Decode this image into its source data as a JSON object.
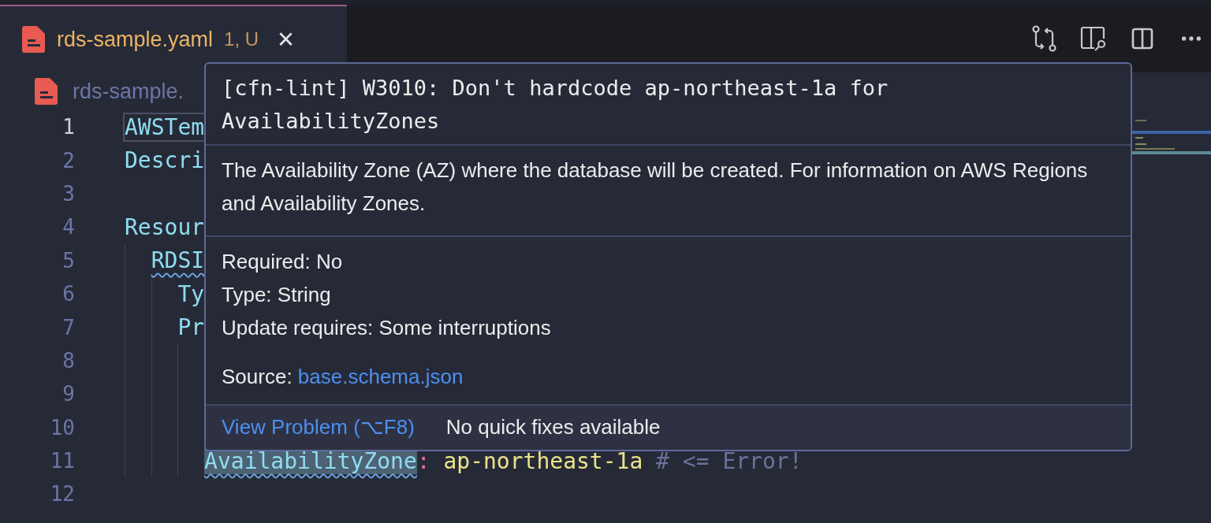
{
  "tab": {
    "filename": "rds-sample.yaml",
    "badge": "1, U",
    "close": "×",
    "selected": true
  },
  "breadcrumb": {
    "text": "rds-sample."
  },
  "editor": {
    "lines": [
      {
        "number": "1",
        "current": true,
        "tokens": [
          {
            "kind": "key",
            "text": "AWSTem",
            "outlined": true,
            "highlighted": false,
            "squiggle": false
          }
        ]
      },
      {
        "number": "2",
        "current": false,
        "tokens": [
          {
            "kind": "key",
            "text": "Descri",
            "outlined": false,
            "highlighted": false,
            "squiggle": false
          }
        ]
      },
      {
        "number": "3",
        "current": false
      },
      {
        "number": "4",
        "current": false,
        "tokens": [
          {
            "kind": "key",
            "text": "Resour",
            "outlined": false,
            "highlighted": false,
            "squiggle": false
          }
        ],
        "children": [
          {
            "number": "5",
            "current": false,
            "tokens": [
              {
                "kind": "key",
                "text": "RDSI",
                "outlined": false,
                "highlighted": false,
                "squiggle": true
              }
            ],
            "children": [
              {
                "number": "6",
                "current": false,
                "tokens": [
                  {
                    "kind": "key",
                    "text": "Ty",
                    "outlined": false,
                    "highlighted": false,
                    "squiggle": false
                  }
                ]
              },
              {
                "number": "7",
                "current": false,
                "tokens": [
                  {
                    "kind": "key",
                    "text": "Pr",
                    "outlined": false,
                    "highlighted": false,
                    "squiggle": false
                  }
                ],
                "children": [
                  {
                    "number": "8",
                    "current": false
                  },
                  {
                    "number": "9",
                    "current": false
                  },
                  {
                    "number": "10",
                    "current": false
                  },
                  {
                    "number": "11",
                    "current": false,
                    "tokens": [
                      {
                        "kind": "key",
                        "text": "AvailabilityZone",
                        "outlined": false,
                        "highlighted": true,
                        "squiggle": true
                      },
                      {
                        "kind": "punct",
                        "text": ":"
                      },
                      {
                        "kind": "string",
                        "text": "ap-northeast-1a"
                      },
                      {
                        "kind": "comment",
                        "text": "# <= Error!"
                      }
                    ]
                  }
                ]
              }
            ]
          }
        ]
      },
      {
        "number": "12",
        "current": false
      }
    ]
  },
  "hover": {
    "title": "[cfn-lint] W3010: Don't hardcode ap-northeast-1a for AvailabilityZones",
    "description": "The Availability Zone (AZ) where the database will be created. For information on AWS Regions and Availability Zones.",
    "properties": [
      "Required: No",
      "Type: String",
      "Update requires: Some interruptions"
    ],
    "source_label": "Source:",
    "source_link": "base.schema.json",
    "action": "View Problem (⌥F8)",
    "status": "No quick fixes available"
  }
}
